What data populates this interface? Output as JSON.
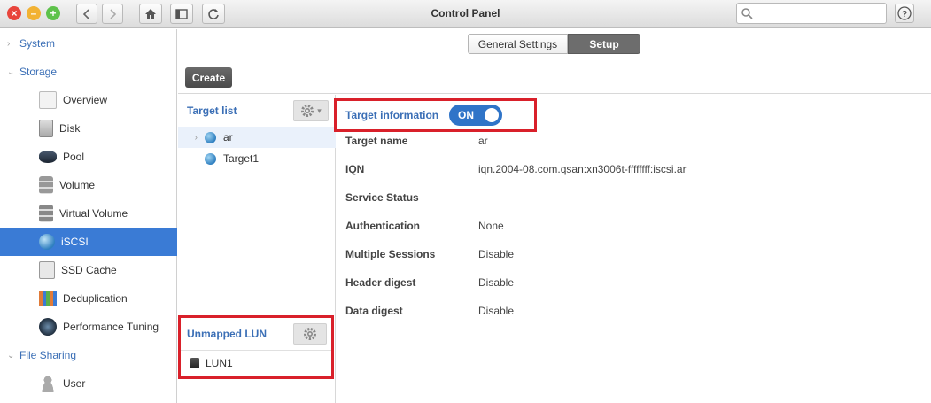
{
  "window": {
    "title": "Control Panel"
  },
  "icons": {
    "close": "close-icon",
    "minimize": "minimize-icon",
    "zoom": "zoom-icon",
    "back": "chevron-left-icon",
    "forward": "chevron-right-icon",
    "home": "home-icon",
    "sidebar_toggle": "sidebar-toggle-icon",
    "refresh": "refresh-icon",
    "search": "search-icon",
    "help": "help-icon",
    "gear": "gear-icon"
  },
  "colors": {
    "accent": "#3a7bd5",
    "link": "#3b6fb6",
    "highlight": "#d9202a",
    "toggle_on": "#2f74c8"
  },
  "sidebar": {
    "sections": [
      {
        "label": "System"
      },
      {
        "label": "Storage"
      },
      {
        "label": "File Sharing"
      }
    ],
    "storage_items": [
      {
        "label": "Overview"
      },
      {
        "label": "Disk"
      },
      {
        "label": "Pool"
      },
      {
        "label": "Volume"
      },
      {
        "label": "Virtual Volume"
      },
      {
        "label": "iSCSI"
      },
      {
        "label": "SSD Cache"
      },
      {
        "label": "Deduplication"
      },
      {
        "label": "Performance Tuning"
      }
    ],
    "file_sharing_items": [
      {
        "label": "User"
      }
    ]
  },
  "tabs": [
    {
      "label": "General Settings"
    },
    {
      "label": "Setup"
    }
  ],
  "toolbar": {
    "create_label": "Create"
  },
  "target_list": {
    "title": "Target list",
    "items": [
      {
        "label": "ar"
      },
      {
        "label": "Target1"
      }
    ]
  },
  "unmapped_lun": {
    "title": "Unmapped LUN",
    "items": [
      {
        "label": "LUN1"
      }
    ]
  },
  "target_info": {
    "title": "Target information",
    "toggle_label": "ON",
    "rows": [
      {
        "label": "Target name",
        "value": "ar"
      },
      {
        "label": "IQN",
        "value": "iqn.2004-08.com.qsan:xn3006t-ffffffff:iscsi.ar"
      },
      {
        "label": "Service Status",
        "value": ""
      },
      {
        "label": "Authentication",
        "value": "None"
      },
      {
        "label": "Multiple Sessions",
        "value": "Disable"
      },
      {
        "label": "Header digest",
        "value": "Disable"
      },
      {
        "label": "Data digest",
        "value": "Disable"
      }
    ]
  }
}
